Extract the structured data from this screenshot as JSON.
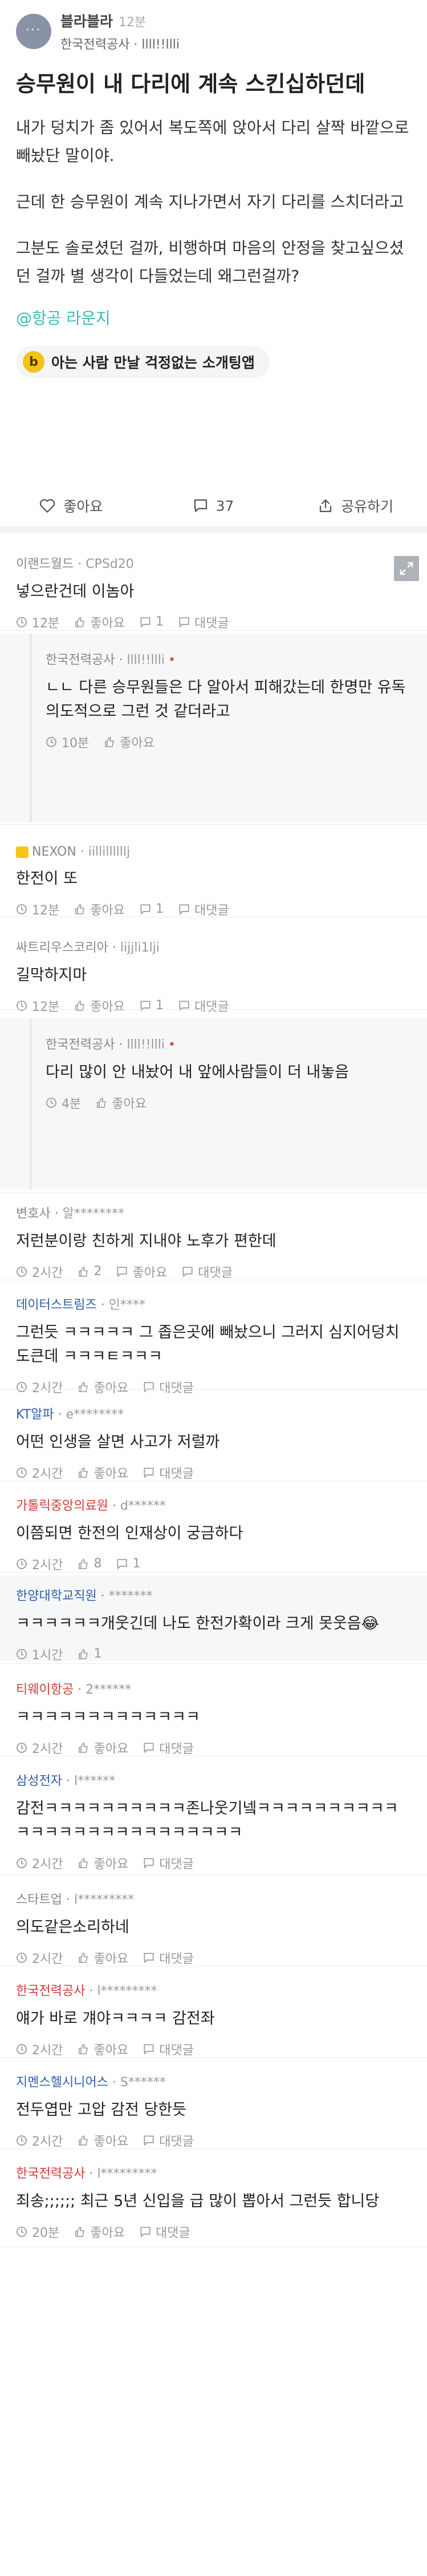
{
  "post": {
    "board": "블라블라",
    "time": "12분",
    "company_author": "한국전력공사 · llll!!llli",
    "title": "승무원이 내 다리에 계속 스킨십하던데",
    "paragraphs": [
      "내가 덩치가 좀 있어서 복도쪽에 앉아서 다리 살짝 바깥으로 빼놨단 말이야.",
      "근데 한 승무원이 계속 지나가면서 자기 다리를 스치더라고",
      "그분도 솔로셨던 걸까, 비행하며 마음의 안정을 찾고싶으셨던 걸까 별 생각이 다들었는데 왜그런걸까?"
    ],
    "topic": "@항공 라운지",
    "ad_coin": "b",
    "ad_text": "아는 사람 만날 걱정없는 소개팅앱",
    "like_label": "좋아요",
    "comment_count": "37",
    "share_label": "공유하기",
    "avatar_glyph": "···"
  },
  "labels": {
    "like": "좋아요",
    "reply": "대댓글"
  },
  "comments": [
    {
      "company": "이랜드월드",
      "nick": "CPSd20",
      "text": "넣으란건데 이놈아",
      "time": "12분",
      "likes": "좋아요",
      "cmts": "1",
      "reply": "대댓글"
    },
    {
      "company": "한국전력공사",
      "nick": "llll!!llli",
      "op": "•",
      "text": "ㄴㄴ 다른 승무원들은 다 알아서 피해갔는데 한명만 유독 의도적으로 그런 것 같더라고",
      "time": "10분",
      "likes": "좋아요"
    },
    {
      "company": "NEXON",
      "nick": "iillillllllj",
      "text": "한전이 또",
      "time": "12분",
      "likes": "좋아요",
      "cmts": "1",
      "reply": "대댓글"
    },
    {
      "company": "싸트리우스코리아",
      "nick": "lijjli1lji",
      "text": "길막하지마",
      "time": "12분",
      "likes": "좋아요",
      "cmts": "1",
      "reply": "대댓글"
    },
    {
      "company": "한국전력공사",
      "nick": "llll!!llli",
      "op": "•",
      "text": "다리 많이 안 내놨어 내 앞에사람들이 더 내놓음",
      "time": "4분",
      "likes": "좋아요"
    },
    {
      "company": "변호사",
      "nick": "알********",
      "text": "저런분이랑 친하게 지내야 노후가 편한데",
      "time": "2시간",
      "likes": "2",
      "cmts": "좋아요",
      "reply": "대댓글"
    },
    {
      "company": "데이터스트림즈",
      "nick": "인****",
      "text": "그런듯 ㅋㅋㅋㅋㅋ 그 좁은곳에 빼놨으니 그러지 심지어덩치도큰데 ㅋㅋㅋㅌㅋㅋㅋ",
      "time": "2시간",
      "likes": "좋아요",
      "reply": "대댓글"
    },
    {
      "company": "KT알파",
      "nick": "e********",
      "text": "어떤 인생을 살면 사고가 저럴까",
      "time": "2시간",
      "likes": "좋아요",
      "reply": "대댓글"
    },
    {
      "company": "가톨릭중앙의료원",
      "nick": "d******",
      "text": "이쯤되면 한전의 인재상이 궁금하다",
      "time": "2시간",
      "likes": "8",
      "cmts": "1"
    },
    {
      "company": "한양대학교직원",
      "nick": "*******",
      "text": "ㅋㅋㅋㅋㅋㅋ개웃긴데 나도 한전가확이라 크게 못웃음😂",
      "time": "1시간",
      "likes": "1"
    },
    {
      "company": "티웨이항공",
      "nick": "2******",
      "text": "ㅋㅋㅋㅋㅋㅋㅋㅋㅋㅋㅋㅋㅋ",
      "time": "2시간",
      "likes": "좋아요",
      "reply": "대댓글"
    },
    {
      "company": "삼성전자",
      "nick": "l******",
      "text": "감전ㅋㅋㅋㅋㅋㅋㅋㅋㅋㅋ존나웃기넼ㅋㅋㅋㅋㅋㅋㅋㅋㅋㅋㅋㅋㅋㅋㅋㅋㅋㅋㅋㅋㅋㅋㅋㅋㅋㅋ",
      "time": "2시간",
      "likes": "좋아요",
      "reply": "대댓글"
    },
    {
      "company": "스타트업",
      "nick": "l*********",
      "text": "의도같은소리하네",
      "time": "2시간",
      "likes": "좋아요",
      "reply": "대댓글"
    },
    {
      "company": "한국전력공사",
      "nick": "l*********",
      "text": "얘가 바로 걔야ㅋㅋㅋㅋ 감전좌",
      "time": "2시간",
      "likes": "좋아요",
      "reply": "대댓글"
    },
    {
      "company": "지멘스헬시니어스",
      "nick": "S******",
      "text": "전두엽만 고압 감전 당한듯",
      "time": "2시간",
      "likes": "좋아요",
      "reply": "대댓글"
    },
    {
      "company": "한국전력공사",
      "nick": "l*********",
      "text": "죄송;;;;;; 최근 5년 신입을 급 많이 뽑아서 그런듯 합니당",
      "time": "20분",
      "likes": "좋아요",
      "reply": "대댓글"
    }
  ]
}
